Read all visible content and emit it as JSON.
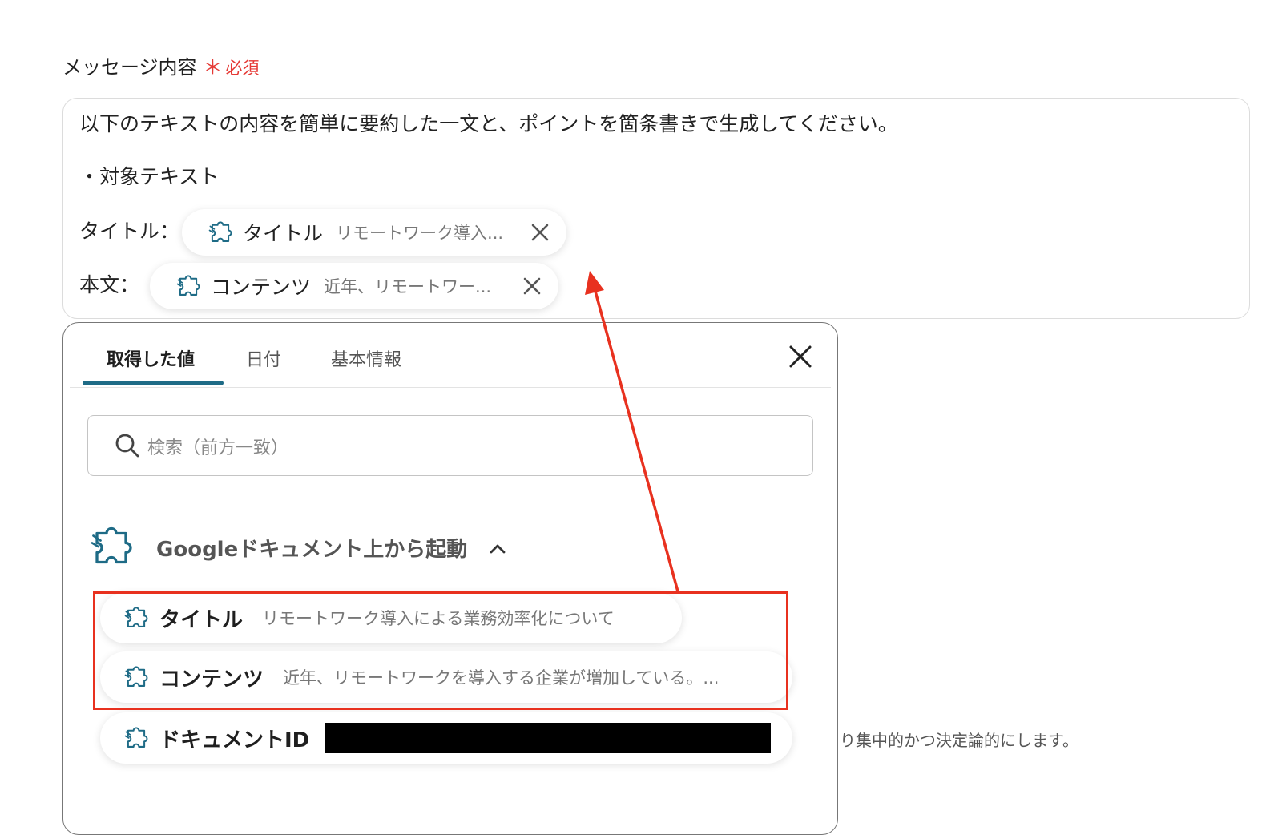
{
  "field": {
    "label": "メッセージ内容",
    "required_star": "＊",
    "required_text": "必須"
  },
  "message": {
    "line1": "以下のテキストの内容を簡単に要約した一文と、ポイントを箇条書きで生成してください。",
    "line2": "・対象テキスト",
    "title_prefix": "タイトル：",
    "body_prefix": "本文：",
    "chip_title": {
      "name": "タイトル",
      "value": "リモートワーク導入..."
    },
    "chip_body": {
      "name": "コンテンツ",
      "value": "近年、リモートワー..."
    }
  },
  "popup": {
    "tabs": [
      "取得した値",
      "日付",
      "基本情報"
    ],
    "search_placeholder": "検索（前方一致）",
    "group_label": "Googleドキュメント上から起動",
    "items": [
      {
        "name": "タイトル",
        "value": "リモートワーク導入による業務効率化について"
      },
      {
        "name": "コンテンツ",
        "value": "近年、リモートワークを導入する企業が増加している。..."
      },
      {
        "name": "ドキュメントID",
        "value": ""
      }
    ]
  },
  "background_text": "り集中的かつ決定論的にします。",
  "colors": {
    "required": "#e53935",
    "tab_accent": "#1e6b86",
    "icon": "#1e6b86",
    "highlight": "#e8311f"
  }
}
